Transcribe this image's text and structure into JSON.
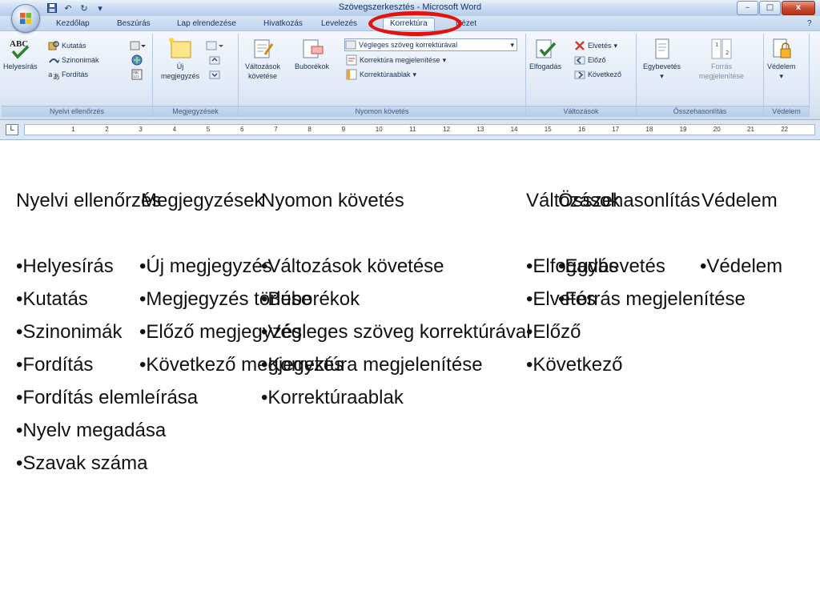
{
  "window": {
    "title": "Szövegszerkesztés - Microsoft Word",
    "controls": {
      "minimize": "–",
      "maximize": "□",
      "close": "x"
    }
  },
  "tabs": [
    {
      "label": "Kezdőlap",
      "active": false
    },
    {
      "label": "Beszúrás",
      "active": false
    },
    {
      "label": "Lap elrendezése",
      "active": false
    },
    {
      "label": "Hivatkozás",
      "active": false
    },
    {
      "label": "Levelezés",
      "active": false
    },
    {
      "label": "Korrektúra",
      "active": true
    },
    {
      "label": "Nézet",
      "active": false
    }
  ],
  "ribbon": {
    "nyelvi": {
      "label": "Nyelvi ellenőrzés",
      "helyesiras": "Helyesírás",
      "kutatas": "Kutatás",
      "szinonimak": "Szinonimák",
      "forditas": "Fordítás"
    },
    "megjegyzesek": {
      "label": "Megjegyzések",
      "uj_line1": "Új",
      "uj_line2": "megjegyzés"
    },
    "nyomon": {
      "label": "Nyomon követés",
      "valtozasok_line1": "Változások",
      "valtozasok_line2": "követése",
      "buborekok": "Buborékok",
      "vegleges": "Végleges szöveg korrektúrával",
      "korrektura_megj": "Korrektúra megjelenítése",
      "korrekturaablak": "Korrektúraablak"
    },
    "valtozasok": {
      "label": "Változások",
      "elfogadas": "Elfogadás",
      "elvetes": "Elvetés",
      "elozo": "Előző",
      "kovetkezo": "Következő"
    },
    "osszehasonlitas": {
      "label": "Összehasonlítás",
      "egybevetes": "Egybevetés",
      "forras_line1": "Forrás",
      "forras_line2": "megjelenítése"
    },
    "vedelem": {
      "label": "Védelem",
      "vedelem": "Védelem"
    }
  },
  "ruler": {
    "numbers": [
      "1",
      "2",
      "3",
      "4",
      "5",
      "6",
      "7",
      "8",
      "9",
      "10",
      "11",
      "12",
      "13",
      "14",
      "15",
      "16",
      "17",
      "18",
      "19",
      "20",
      "21",
      "22"
    ]
  },
  "slide": {
    "headers": {
      "nyelvi": "Nyelvi ellenőrzés",
      "megjegyzesek": "Megjegyzések",
      "nyomon": "Nyomon követés",
      "valtozasok": "Változások",
      "osszehasonlitas": "Összehasonlítás",
      "vedelem": "Védelem"
    },
    "nyelvi": [
      "•Helyesírás",
      "•Kutatás",
      "•Szinonimák",
      "•Fordítás",
      "•Fordítás elemleírása",
      "•Nyelv megadása",
      "•Szavak száma"
    ],
    "megjegyzesek": [
      "•Új megjegyzés",
      "•Megjegyzés törlése",
      "•Előző megjegyzés",
      "•Következő megjegyzés"
    ],
    "nyomon": [
      "•Változások követése",
      "•Buborékok",
      "•Végleges szöveg korrektúrával",
      "•Korrektúra megjelenítése",
      "•Korrektúraablak"
    ],
    "valtozasok": [
      "•Elfogadás",
      "•Elvetés",
      "•Előző",
      "•Következő"
    ],
    "osszehasonlitas": [
      "•Egybevetés",
      "•Forrás megjelenítése"
    ],
    "vedelem": [
      "•Védelem"
    ]
  }
}
